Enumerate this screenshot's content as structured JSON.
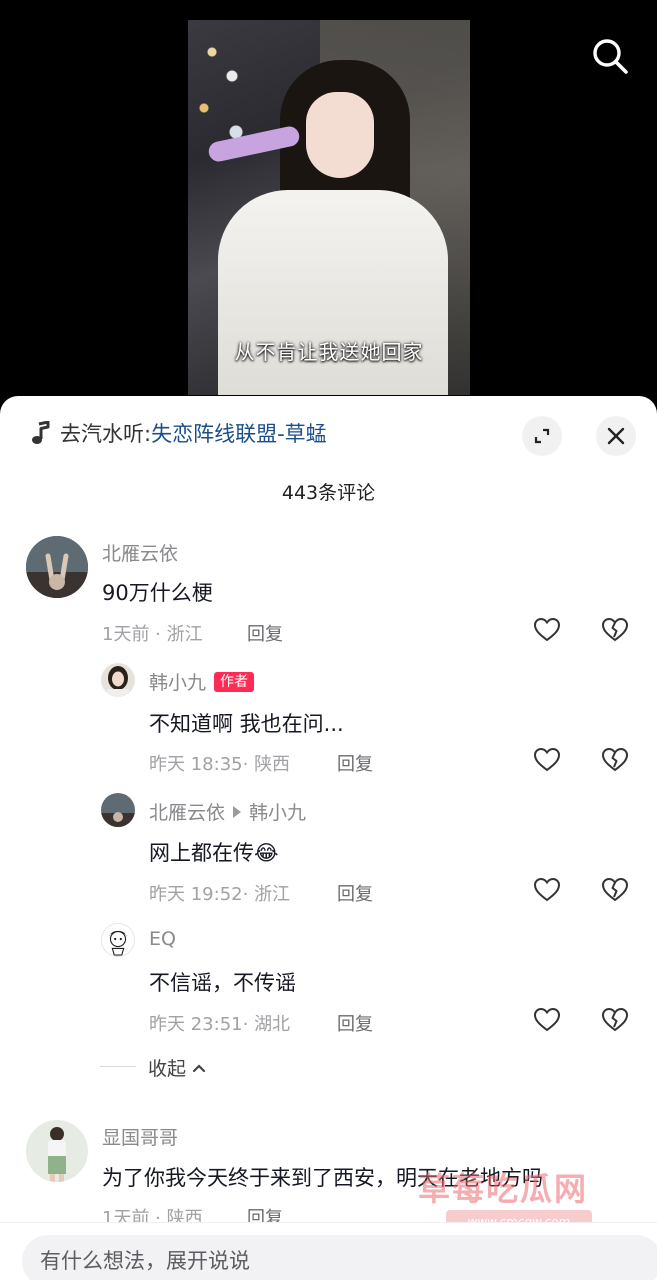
{
  "video": {
    "subtitle": "从不肯让我送她回家"
  },
  "music": {
    "prefix": "去汽水听:",
    "title": "失恋阵线联盟-草蜢"
  },
  "comment_count": "443条评论",
  "comments": [
    {
      "username": "北雁云依",
      "text": "90万什么梗",
      "time": "1天前",
      "location": "浙江",
      "reply_label": "回复"
    },
    {
      "username": "韩小九",
      "badge": "作者",
      "text": "不知道啊 我也在问...",
      "time": "昨天 18:35",
      "location": "陕西",
      "reply_label": "回复"
    },
    {
      "username": "北雁云依",
      "reply_to": "韩小九",
      "text": "网上都在传",
      "emoji": "😂",
      "time": "昨天 19:52",
      "location": "浙江",
      "reply_label": "回复"
    },
    {
      "username": "EQ",
      "text": "不信谣，不传谣",
      "time": "昨天 23:51",
      "location": "湖北",
      "reply_label": "回复"
    },
    {
      "username": "显国哥哥",
      "text": "为了你我今天终于来到了西安，明天在老地方吗",
      "time": "1天前",
      "location": "陕西",
      "reply_label": "回复"
    }
  ],
  "collapse_label": "收起",
  "watermark": {
    "text": "草莓吃瓜网",
    "url": "www.cmcgw.com"
  },
  "input": {
    "placeholder": "有什么想法，展开说说"
  },
  "colors": {
    "author_badge": "#fe2c55",
    "music_link": "#1c4e8a"
  },
  "icons": [
    "search-icon",
    "music-note-icon",
    "expand-icon",
    "close-icon",
    "heart-icon",
    "broken-heart-icon",
    "chevron-up-icon"
  ]
}
